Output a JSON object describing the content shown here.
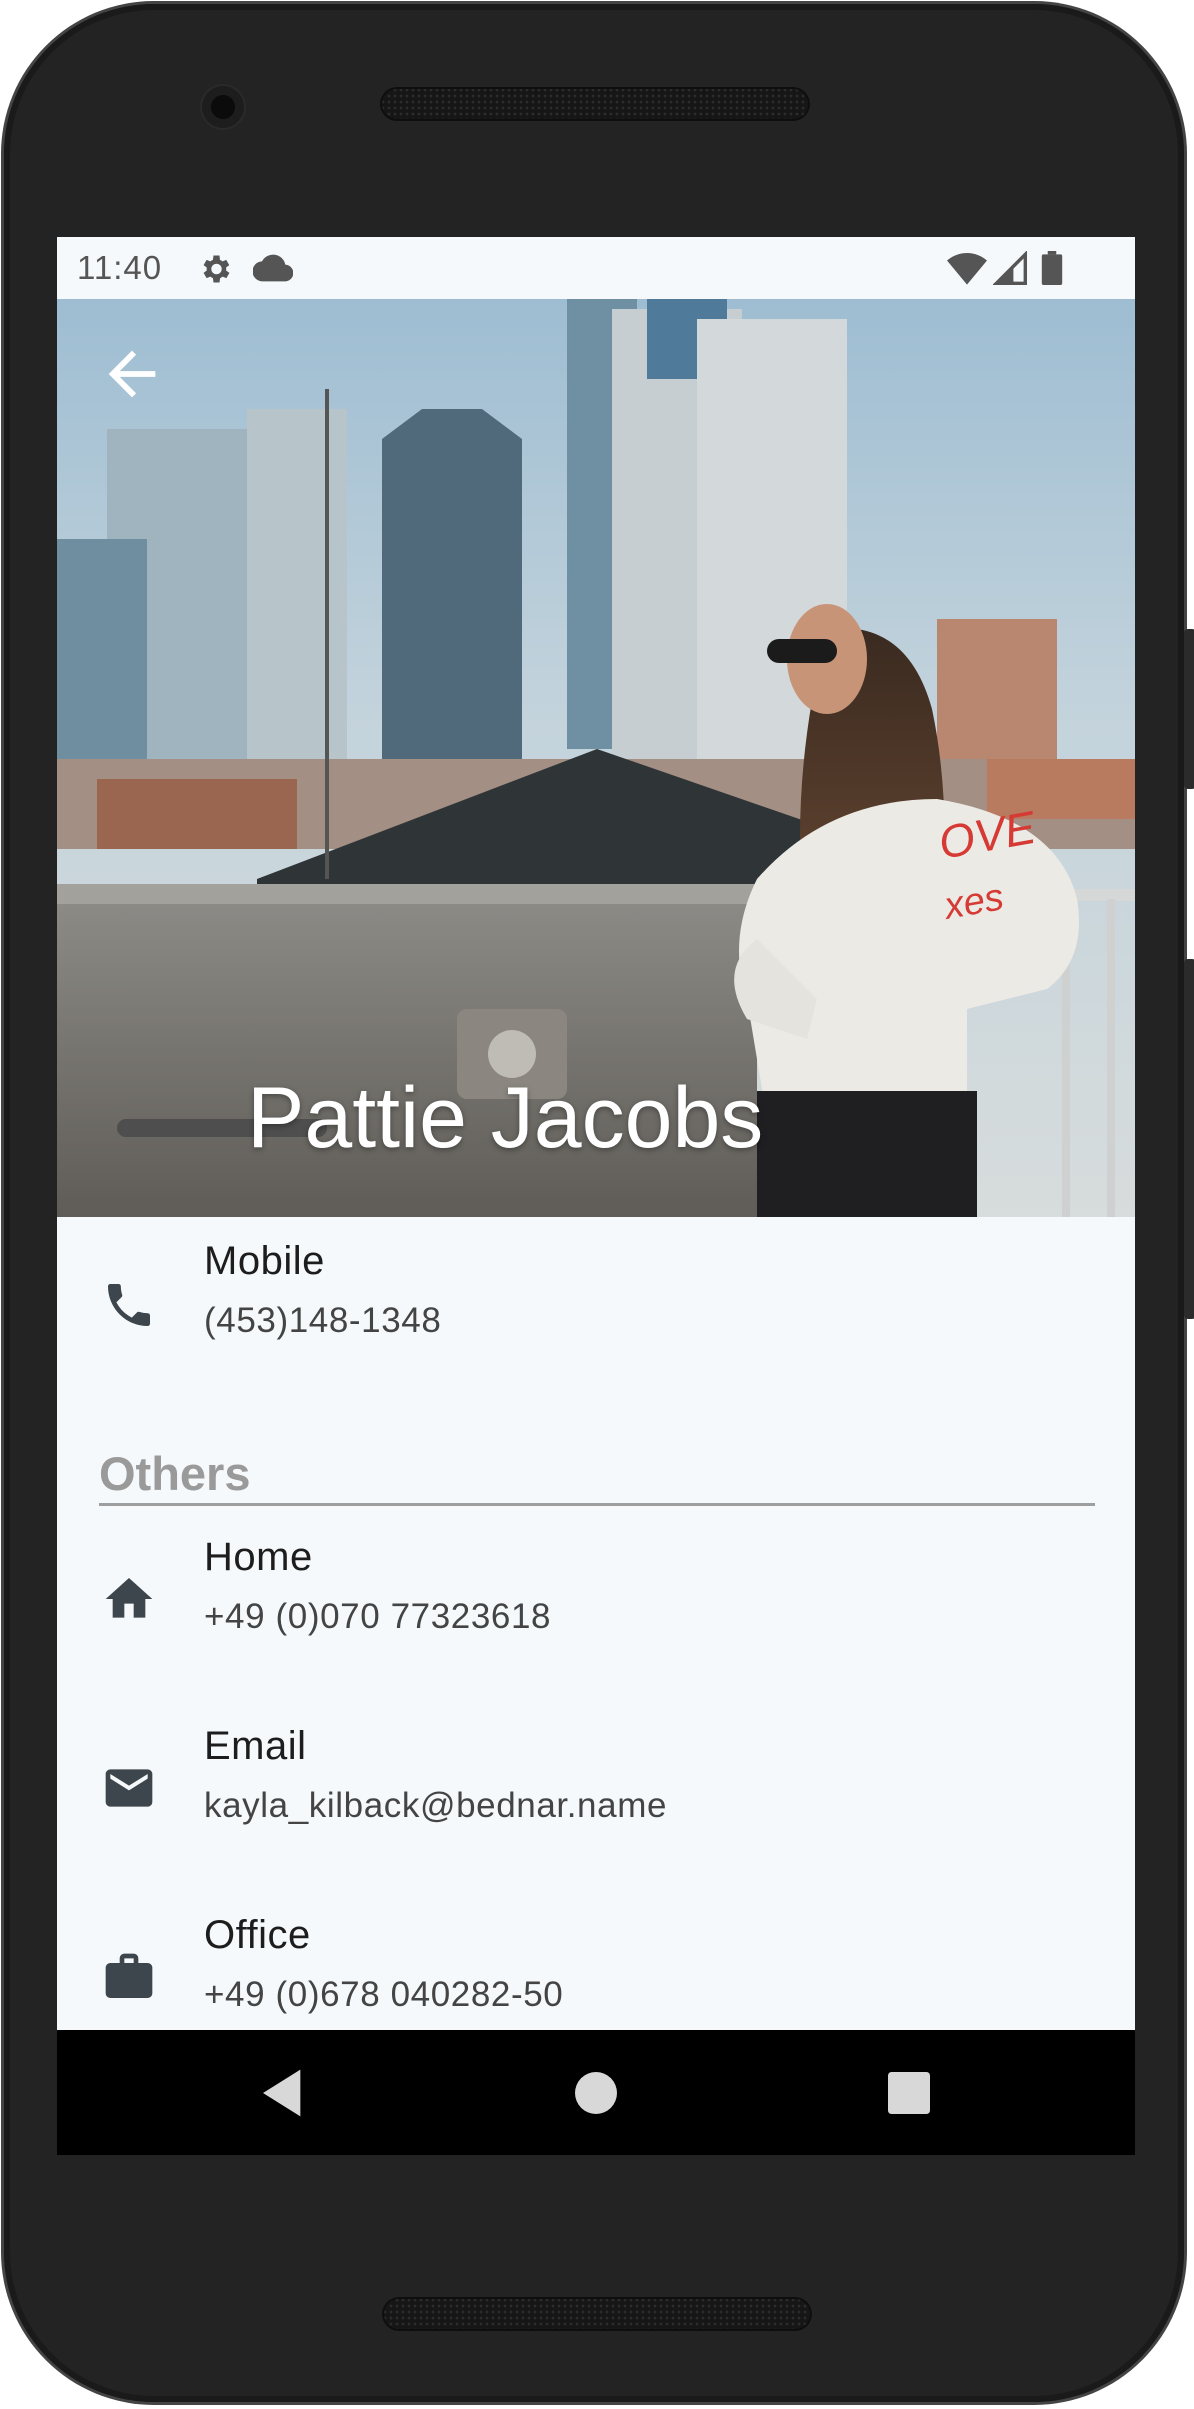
{
  "status_bar": {
    "time": "11:40",
    "left_icons": [
      "gear-icon",
      "cloud-icon"
    ],
    "right_icons": [
      "wifi-icon",
      "signal-icon",
      "battery-icon"
    ]
  },
  "contact": {
    "name": "Pattie Jacobs",
    "hero_image": "city-rooftop-photo"
  },
  "primary": {
    "label": "Mobile",
    "value": "(453)148-1348",
    "icon": "phone-icon"
  },
  "others": {
    "section_title": "Others",
    "items": [
      {
        "label": "Home",
        "value": "+49 (0)070 77323618",
        "icon": "home-icon"
      },
      {
        "label": "Email",
        "value": "kayla_kilback@bednar.name",
        "icon": "email-icon"
      },
      {
        "label": "Office",
        "value": "+49 (0)678 040282-50",
        "icon": "briefcase-icon"
      }
    ]
  },
  "nav_bar": {
    "buttons": [
      "back-triangle-icon",
      "home-circle-icon",
      "recents-square-icon"
    ]
  },
  "colors": {
    "screen_bg": "#f5f9fb",
    "icon_color": "#3d464c",
    "section_title": "#9a9a9a",
    "phone_body": "#232323"
  }
}
